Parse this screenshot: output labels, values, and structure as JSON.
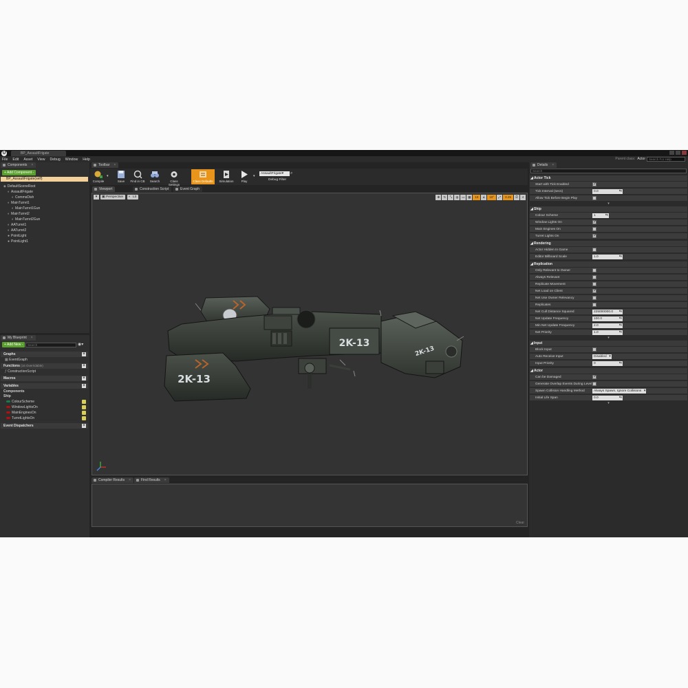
{
  "window": {
    "tab_title": "BP_AssaultFrigate",
    "parent_class_label": "Parent class:",
    "parent_class_value": "Actor",
    "help_search_placeholder": "Search For Help"
  },
  "menu": [
    "File",
    "Edit",
    "Asset",
    "View",
    "Debug",
    "Window",
    "Help"
  ],
  "components_panel": {
    "tab_label": "Components",
    "add_button": "+ Add Component -",
    "self_item": "BP_AssaultFrigate(self)",
    "tree": [
      {
        "label": "DefaultSceneRoot",
        "depth": 0
      },
      {
        "label": "AssaultFrigate",
        "depth": 1
      },
      {
        "label": "CommsDish",
        "depth": 2
      },
      {
        "label": "MainTurret1",
        "depth": 1
      },
      {
        "label": "MainTurret1Gun",
        "depth": 2
      },
      {
        "label": "MainTurret2",
        "depth": 1
      },
      {
        "label": "MainTurret2Gun",
        "depth": 2
      },
      {
        "label": "AATurret1",
        "depth": 1
      },
      {
        "label": "AATurret2",
        "depth": 1
      },
      {
        "label": "PointLight",
        "depth": 1
      },
      {
        "label": "PointLight1",
        "depth": 1
      }
    ]
  },
  "my_blueprint": {
    "tab_label": "My Blueprint",
    "add_new": "+ Add New -",
    "search_placeholder": "Search",
    "graphs_label": "Graphs",
    "event_graph": "EventGraph",
    "functions_label": "Functions",
    "functions_count": "(16 Overridable)",
    "construction_script": "ConstructionScript",
    "macros_label": "Macros",
    "variables_label": "Variables",
    "components_label": "Components",
    "ship_label": "Ship",
    "variables": [
      "ColourScheme",
      "WindowLightsOn",
      "MainEnginesOn",
      "TurretLightsOn"
    ],
    "event_dispatchers": "Event Dispatchers"
  },
  "toolbar": {
    "tab_label": "Toolbar",
    "buttons": [
      "Compile",
      "Save",
      "Find in CB",
      "Search",
      "Class Settings",
      "Class Defaults",
      "Simulation",
      "Play"
    ],
    "debug_object": "AssaultFrigate",
    "debug_filter_label": "Debug Filter"
  },
  "editor_tabs": [
    "Viewport",
    "Construction Script",
    "Event Graph"
  ],
  "viewport": {
    "perspective": "Perspective",
    "lit": "Lit",
    "grid_snap": "10",
    "rotation_snap": "10°",
    "scale_snap": "0.25",
    "camera_speed": "4",
    "hull_marking": "2K-13"
  },
  "lower_tabs": [
    "Compiler Results",
    "Find Results"
  ],
  "clear_label": "Clear",
  "details": {
    "tab_label": "Details",
    "search_placeholder": "Search",
    "sections": [
      {
        "title": "Actor Tick",
        "rows": [
          {
            "label": "Start with Tick Enabled",
            "type": "check",
            "checked": true
          },
          {
            "label": "Tick Interval (secs)",
            "type": "num",
            "value": "0.0"
          },
          {
            "label": "Allow Tick Before Begin Play",
            "type": "check",
            "checked": false
          }
        ]
      },
      {
        "title": "Ship",
        "rows": [
          {
            "label": "Colour Scheme",
            "type": "num",
            "value": "1"
          },
          {
            "label": "Window Lights On",
            "type": "check",
            "checked": true
          },
          {
            "label": "Main Engines On",
            "type": "check",
            "checked": false
          },
          {
            "label": "Turret Lights On",
            "type": "check",
            "checked": true
          }
        ]
      },
      {
        "title": "Rendering",
        "rows": [
          {
            "label": "Actor Hidden In Game",
            "type": "check",
            "checked": false
          },
          {
            "label": "Editor Billboard Scale",
            "type": "num",
            "value": "1.0"
          }
        ]
      },
      {
        "title": "Replication",
        "rows": [
          {
            "label": "Only Relevant to Owner",
            "type": "check",
            "checked": false
          },
          {
            "label": "Always Relevant",
            "type": "check",
            "checked": false
          },
          {
            "label": "Replicate Movement",
            "type": "check",
            "checked": false
          },
          {
            "label": "Net Load on Client",
            "type": "check",
            "checked": true
          },
          {
            "label": "Net Use Owner Relevancy",
            "type": "check",
            "checked": false
          },
          {
            "label": "Replicates",
            "type": "check",
            "checked": false
          },
          {
            "label": "Net Cull Distance Squared",
            "type": "num",
            "value": "225000000.0"
          },
          {
            "label": "Net Update Frequency",
            "type": "num",
            "value": "100.0"
          },
          {
            "label": "Min Net Update Frequency",
            "type": "num",
            "value": "2.0"
          },
          {
            "label": "Net Priority",
            "type": "num",
            "value": "1.0"
          }
        ]
      },
      {
        "title": "Input",
        "rows": [
          {
            "label": "Block Input",
            "type": "check",
            "checked": false
          },
          {
            "label": "Auto Receive Input",
            "type": "dd",
            "value": "Disabled"
          },
          {
            "label": "Input Priority",
            "type": "num",
            "value": "0"
          }
        ]
      },
      {
        "title": "Actor",
        "rows": [
          {
            "label": "Can be Damaged",
            "type": "check",
            "checked": true
          },
          {
            "label": "Generate Overlap Events During Level St",
            "type": "check",
            "checked": false
          },
          {
            "label": "Spawn Collision Handling Method",
            "type": "dd",
            "value": "Always Spawn, Ignore Collisions"
          },
          {
            "label": "Initial Life Span",
            "type": "num",
            "value": "0.0"
          }
        ]
      }
    ]
  },
  "colors": {
    "accent_orange": "#e9951c",
    "add_green": "#5aa02c",
    "selection": "#f2d29a",
    "var_bool": "#b20f0f"
  }
}
